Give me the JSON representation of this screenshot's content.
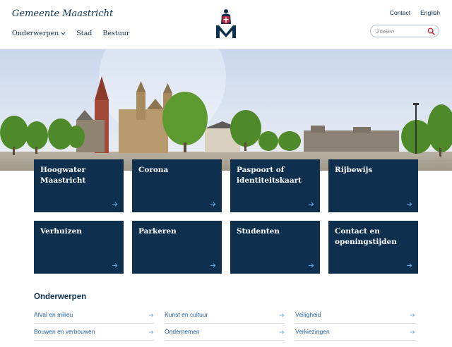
{
  "header": {
    "brand": "Gemeente Maastricht",
    "nav": [
      {
        "label": "Onderwerpen",
        "has_dropdown": true
      },
      {
        "label": "Stad"
      },
      {
        "label": "Bestuur"
      }
    ],
    "top_links": [
      "Contact",
      "English"
    ],
    "search": {
      "placeholder": "Zoeken",
      "icon": "search-icon"
    },
    "logo_icon": "municipal-crest-icon"
  },
  "tiles": [
    {
      "label": "Hoogwater Maastricht",
      "icon": "arrow-right-icon"
    },
    {
      "label": "Corona",
      "icon": "arrow-right-icon"
    },
    {
      "label": "Paspoort of identiteitskaart",
      "icon": "arrow-right-icon"
    },
    {
      "label": "Rijbewijs",
      "icon": "arrow-right-icon"
    },
    {
      "label": "Verhuizen",
      "icon": "arrow-right-icon"
    },
    {
      "label": "Parkeren",
      "icon": "arrow-right-icon"
    },
    {
      "label": "Studenten",
      "icon": "arrow-right-icon"
    },
    {
      "label": "Contact en openingstijden",
      "icon": "arrow-right-icon"
    }
  ],
  "topics": {
    "title": "Onderwerpen",
    "items": [
      "Afval en milieu",
      "Kunst en cultuur",
      "Veiligheid",
      "Bouwen en verbouwen",
      "Ondernemen",
      "Verkiezingen"
    ]
  },
  "colors": {
    "navy": "#0e2f4d",
    "link": "#1f5f9f",
    "accent_red": "#c3263a"
  }
}
